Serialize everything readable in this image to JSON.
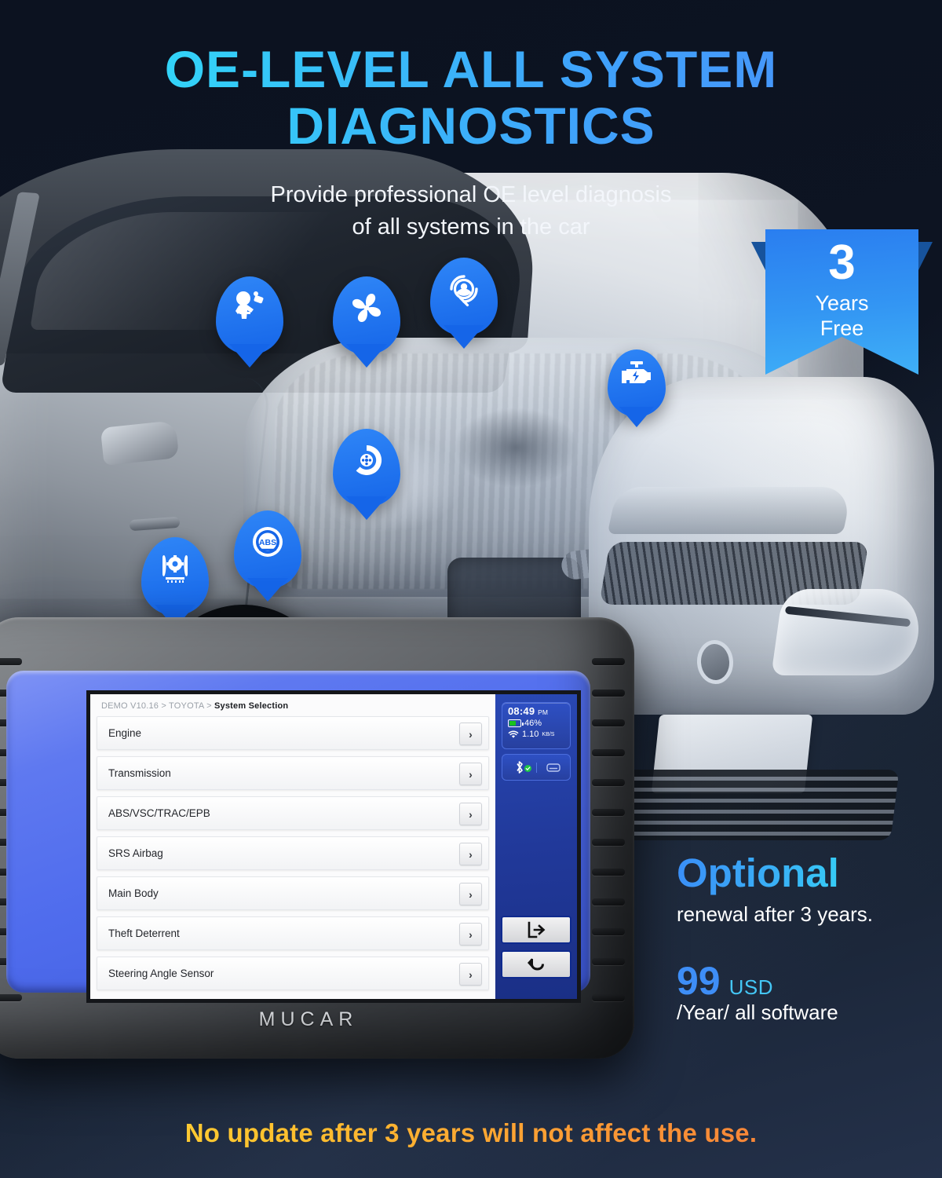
{
  "headline": {
    "line1": "OE-LEVEL ALL SYSTEM",
    "line2": "DIAGNOSTICS",
    "accent_start": "#2ee6f7",
    "accent_end": "#4b8ef9"
  },
  "subhead": {
    "line1": "Provide professional OE level diagnosis",
    "line2": "of all systems in the car"
  },
  "ribbon": {
    "number": "3",
    "line1": "Years",
    "line2": "Free",
    "color": "#2a7ef0"
  },
  "pins": [
    {
      "name": "srs-airbag-icon",
      "label": "SRS Airbag"
    },
    {
      "name": "hvac-fan-icon",
      "label": "HVAC"
    },
    {
      "name": "steering-wheel-icon",
      "label": "Steering Angle"
    },
    {
      "name": "engine-check-icon",
      "label": "Engine"
    },
    {
      "name": "brake-disc-icon",
      "label": "Brake"
    },
    {
      "name": "abs-icon",
      "label": "ABS"
    },
    {
      "name": "tpms-icon",
      "label": "TPMS"
    }
  ],
  "device": {
    "brand": "MUCAR",
    "screen": {
      "breadcrumb": {
        "prefix": "DEMO V10.16 > TOYOTA > ",
        "current": "System Selection"
      },
      "rows": [
        {
          "label": "Engine"
        },
        {
          "label": "Transmission"
        },
        {
          "label": "ABS/VSC/TRAC/EPB"
        },
        {
          "label": "SRS Airbag"
        },
        {
          "label": "Main Body"
        },
        {
          "label": "Theft Deterrent"
        },
        {
          "label": "Steering Angle Sensor"
        }
      ],
      "row_arrow_glyph": "›",
      "status": {
        "time": "08:49",
        "meridiem": "PM",
        "battery": "46%",
        "network_speed": "1.10",
        "network_unit": "KB/S"
      },
      "connections": [
        {
          "name": "bluetooth-connected-icon"
        },
        {
          "name": "vci-device-icon"
        }
      ],
      "nav": [
        {
          "name": "exit-button"
        },
        {
          "name": "back-button"
        }
      ]
    }
  },
  "pricing": {
    "title": "Optional",
    "subtitle": "renewal after 3 years.",
    "amount": "99",
    "currency": "USD",
    "terms": "/Year/ all software"
  },
  "footer": {
    "text": "No update after 3 years will not affect the use.",
    "gradient_start": "#ffd93b",
    "gradient_end": "#f4713c"
  }
}
